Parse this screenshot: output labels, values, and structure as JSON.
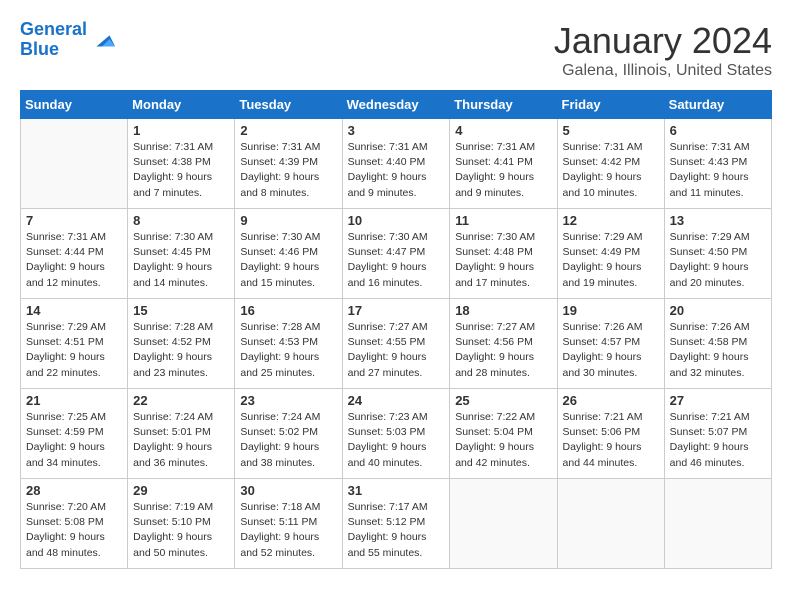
{
  "header": {
    "logo_line1": "General",
    "logo_line2": "Blue",
    "title": "January 2024",
    "subtitle": "Galena, Illinois, United States"
  },
  "days_of_week": [
    "Sunday",
    "Monday",
    "Tuesday",
    "Wednesday",
    "Thursday",
    "Friday",
    "Saturday"
  ],
  "weeks": [
    [
      {
        "day": "",
        "info": ""
      },
      {
        "day": "1",
        "info": "Sunrise: 7:31 AM\nSunset: 4:38 PM\nDaylight: 9 hours\nand 7 minutes."
      },
      {
        "day": "2",
        "info": "Sunrise: 7:31 AM\nSunset: 4:39 PM\nDaylight: 9 hours\nand 8 minutes."
      },
      {
        "day": "3",
        "info": "Sunrise: 7:31 AM\nSunset: 4:40 PM\nDaylight: 9 hours\nand 9 minutes."
      },
      {
        "day": "4",
        "info": "Sunrise: 7:31 AM\nSunset: 4:41 PM\nDaylight: 9 hours\nand 9 minutes."
      },
      {
        "day": "5",
        "info": "Sunrise: 7:31 AM\nSunset: 4:42 PM\nDaylight: 9 hours\nand 10 minutes."
      },
      {
        "day": "6",
        "info": "Sunrise: 7:31 AM\nSunset: 4:43 PM\nDaylight: 9 hours\nand 11 minutes."
      }
    ],
    [
      {
        "day": "7",
        "info": "Sunrise: 7:31 AM\nSunset: 4:44 PM\nDaylight: 9 hours\nand 12 minutes."
      },
      {
        "day": "8",
        "info": "Sunrise: 7:30 AM\nSunset: 4:45 PM\nDaylight: 9 hours\nand 14 minutes."
      },
      {
        "day": "9",
        "info": "Sunrise: 7:30 AM\nSunset: 4:46 PM\nDaylight: 9 hours\nand 15 minutes."
      },
      {
        "day": "10",
        "info": "Sunrise: 7:30 AM\nSunset: 4:47 PM\nDaylight: 9 hours\nand 16 minutes."
      },
      {
        "day": "11",
        "info": "Sunrise: 7:30 AM\nSunset: 4:48 PM\nDaylight: 9 hours\nand 17 minutes."
      },
      {
        "day": "12",
        "info": "Sunrise: 7:29 AM\nSunset: 4:49 PM\nDaylight: 9 hours\nand 19 minutes."
      },
      {
        "day": "13",
        "info": "Sunrise: 7:29 AM\nSunset: 4:50 PM\nDaylight: 9 hours\nand 20 minutes."
      }
    ],
    [
      {
        "day": "14",
        "info": "Sunrise: 7:29 AM\nSunset: 4:51 PM\nDaylight: 9 hours\nand 22 minutes."
      },
      {
        "day": "15",
        "info": "Sunrise: 7:28 AM\nSunset: 4:52 PM\nDaylight: 9 hours\nand 23 minutes."
      },
      {
        "day": "16",
        "info": "Sunrise: 7:28 AM\nSunset: 4:53 PM\nDaylight: 9 hours\nand 25 minutes."
      },
      {
        "day": "17",
        "info": "Sunrise: 7:27 AM\nSunset: 4:55 PM\nDaylight: 9 hours\nand 27 minutes."
      },
      {
        "day": "18",
        "info": "Sunrise: 7:27 AM\nSunset: 4:56 PM\nDaylight: 9 hours\nand 28 minutes."
      },
      {
        "day": "19",
        "info": "Sunrise: 7:26 AM\nSunset: 4:57 PM\nDaylight: 9 hours\nand 30 minutes."
      },
      {
        "day": "20",
        "info": "Sunrise: 7:26 AM\nSunset: 4:58 PM\nDaylight: 9 hours\nand 32 minutes."
      }
    ],
    [
      {
        "day": "21",
        "info": "Sunrise: 7:25 AM\nSunset: 4:59 PM\nDaylight: 9 hours\nand 34 minutes."
      },
      {
        "day": "22",
        "info": "Sunrise: 7:24 AM\nSunset: 5:01 PM\nDaylight: 9 hours\nand 36 minutes."
      },
      {
        "day": "23",
        "info": "Sunrise: 7:24 AM\nSunset: 5:02 PM\nDaylight: 9 hours\nand 38 minutes."
      },
      {
        "day": "24",
        "info": "Sunrise: 7:23 AM\nSunset: 5:03 PM\nDaylight: 9 hours\nand 40 minutes."
      },
      {
        "day": "25",
        "info": "Sunrise: 7:22 AM\nSunset: 5:04 PM\nDaylight: 9 hours\nand 42 minutes."
      },
      {
        "day": "26",
        "info": "Sunrise: 7:21 AM\nSunset: 5:06 PM\nDaylight: 9 hours\nand 44 minutes."
      },
      {
        "day": "27",
        "info": "Sunrise: 7:21 AM\nSunset: 5:07 PM\nDaylight: 9 hours\nand 46 minutes."
      }
    ],
    [
      {
        "day": "28",
        "info": "Sunrise: 7:20 AM\nSunset: 5:08 PM\nDaylight: 9 hours\nand 48 minutes."
      },
      {
        "day": "29",
        "info": "Sunrise: 7:19 AM\nSunset: 5:10 PM\nDaylight: 9 hours\nand 50 minutes."
      },
      {
        "day": "30",
        "info": "Sunrise: 7:18 AM\nSunset: 5:11 PM\nDaylight: 9 hours\nand 52 minutes."
      },
      {
        "day": "31",
        "info": "Sunrise: 7:17 AM\nSunset: 5:12 PM\nDaylight: 9 hours\nand 55 minutes."
      },
      {
        "day": "",
        "info": ""
      },
      {
        "day": "",
        "info": ""
      },
      {
        "day": "",
        "info": ""
      }
    ]
  ]
}
